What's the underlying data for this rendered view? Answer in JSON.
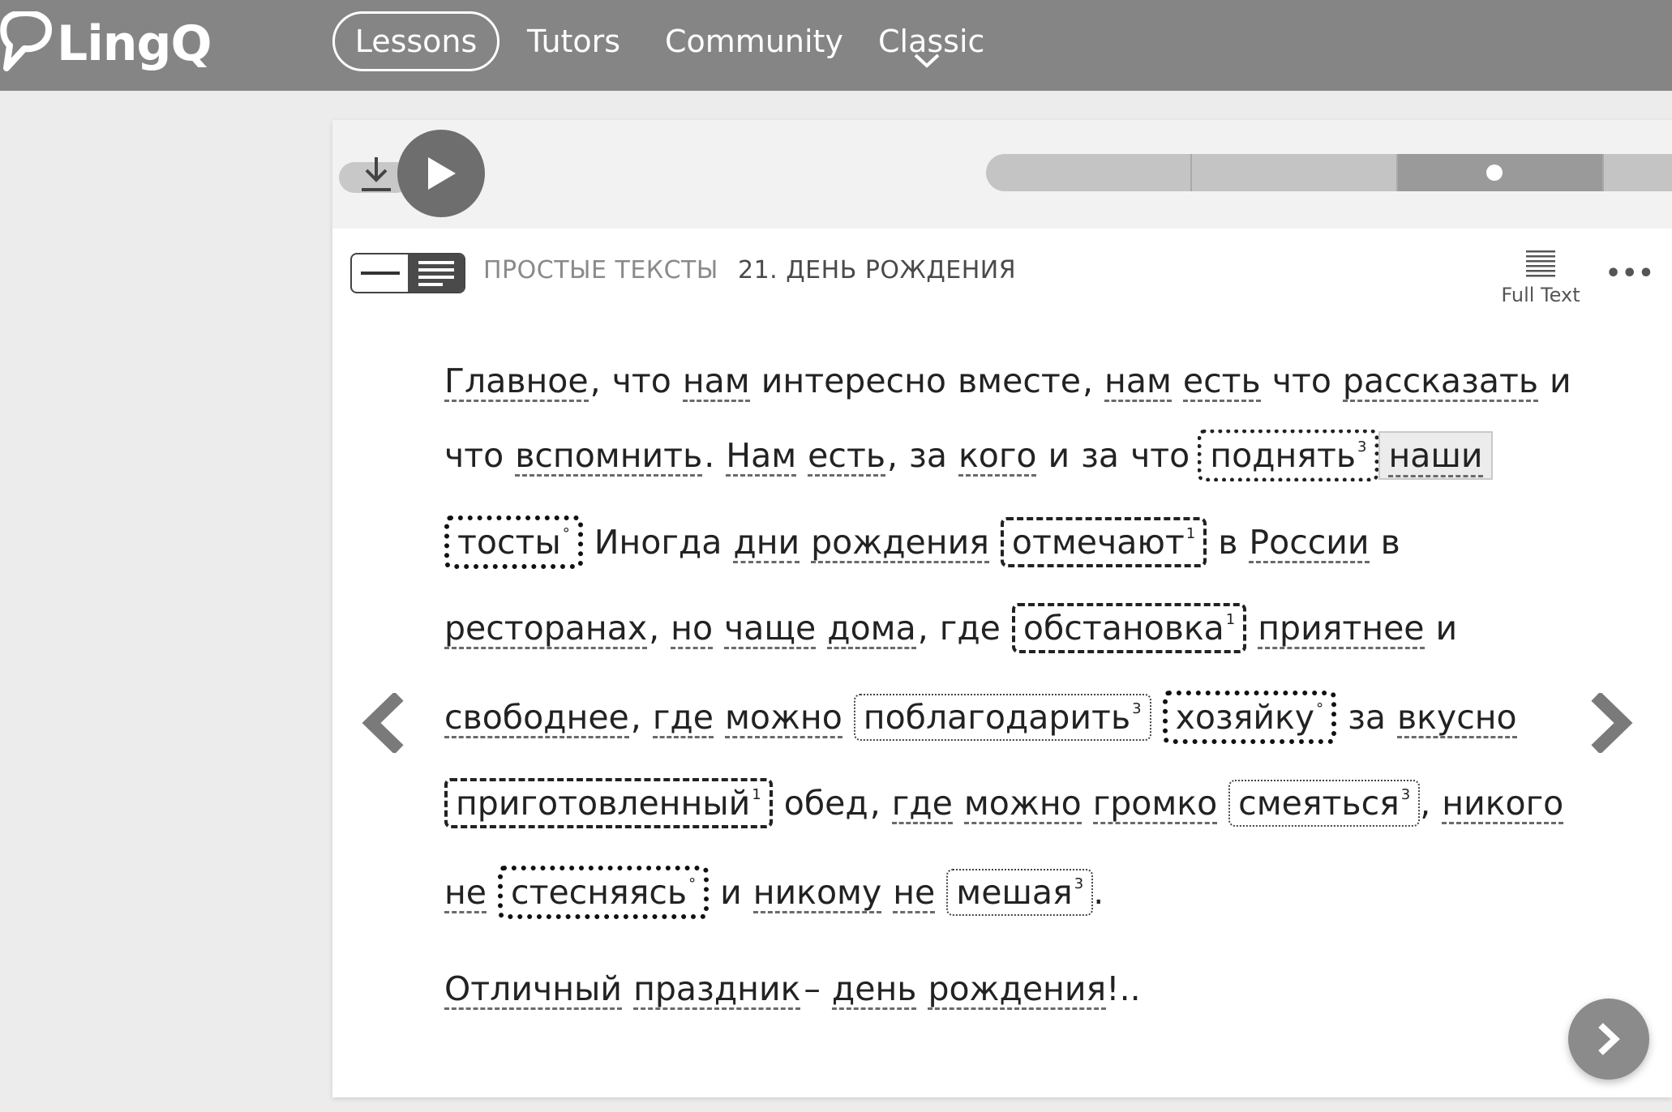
{
  "app": {
    "logo_text": "LingQ"
  },
  "nav": {
    "lessons": "Lessons",
    "tutors": "Tutors",
    "community": "Community",
    "classic": "Classic"
  },
  "player": {
    "progress_fraction": 0.6
  },
  "lesson": {
    "course_title": "ПРОСТЫЕ ТЕКСТЫ",
    "lesson_title": "21. ДЕНЬ РОЖДЕНИЯ",
    "full_text_label": "Full Text",
    "more_label": "•••"
  },
  "text": {
    "l1": [
      "Главное",
      ",",
      "что",
      "нам",
      "интересно",
      "вместе",
      ",",
      "нам",
      "есть",
      "что",
      "рассказать",
      "и"
    ],
    "l2": [
      "что",
      "вспомнить",
      ".",
      "Нам",
      "есть",
      ",",
      "за",
      "кого",
      "и",
      "за",
      "что",
      "поднять",
      "3",
      "наши"
    ],
    "l3": [
      "тосты",
      "°",
      "Иногда",
      "дни",
      "рождения",
      "отмечают",
      "1",
      "в",
      "России",
      "в"
    ],
    "l4": [
      "ресторанах",
      ",",
      "но",
      "чаще",
      "дома",
      ",",
      "где",
      "обстановка",
      "1",
      "приятнее",
      "и"
    ],
    "l5": [
      "свободнее",
      ",",
      "где",
      "можно",
      "поблагодарить",
      "3",
      "хозяйку",
      "°",
      "за",
      "вкусно"
    ],
    "l6": [
      "приготовленный",
      "1",
      "обед",
      ",",
      "где",
      "можно",
      "громко",
      "смеяться",
      "3",
      ",",
      "никого"
    ],
    "l7": [
      "не",
      "стесняясь",
      "°",
      "и",
      "никому",
      "не",
      "мешая",
      "3",
      "."
    ],
    "l8": [
      "Отличный",
      "праздник",
      "–",
      "день",
      "рождения",
      "!.."
    ]
  },
  "colors": {
    "topbar": "#858585",
    "background": "#ececec",
    "card": "#ffffff",
    "text": "#222222"
  },
  "icons": {
    "logo": "lingq-speech-bubble-icon",
    "download": "download-icon",
    "play": "play-icon",
    "prev": "chevron-left-icon",
    "next": "chevron-right-icon",
    "fab": "chevron-right-icon",
    "full_text": "lines-icon",
    "view_toggle": "view-mode-icon"
  }
}
